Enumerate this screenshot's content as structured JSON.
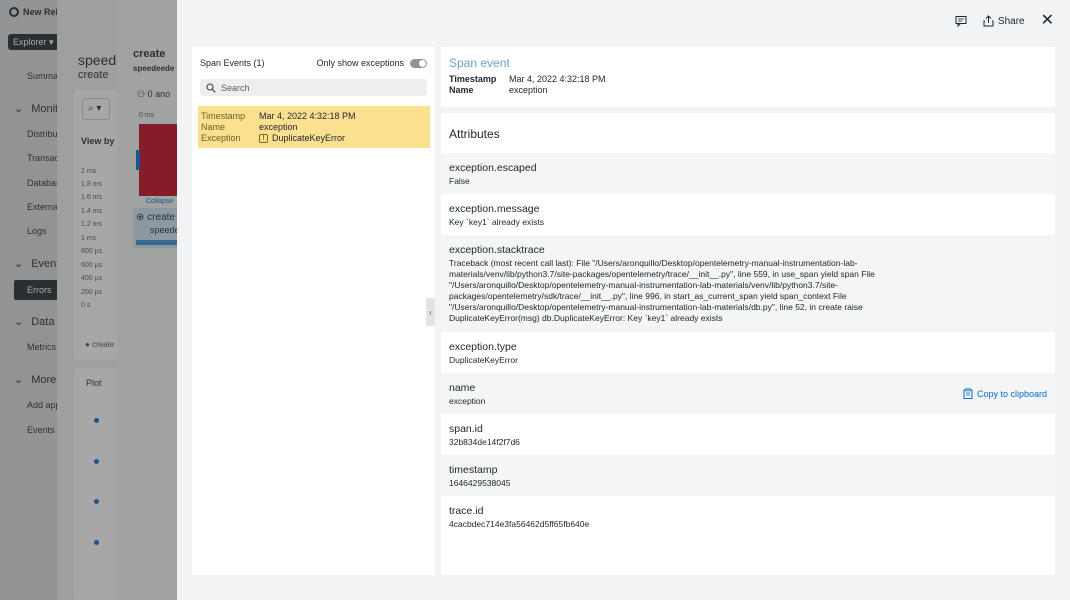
{
  "app": {
    "brand": "New Relic",
    "explorer_label": "Explorer",
    "nav": [
      "Summar",
      "Distribu",
      "Transac",
      "Databas",
      "External",
      "Logs",
      "Metrics",
      "Add app",
      "Events e"
    ],
    "sections": [
      "Monito",
      "Events",
      "Data",
      "More v"
    ],
    "active_item": "Errors"
  },
  "background": {
    "title": "speede",
    "subtitle": "create",
    "view_by": "View by",
    "y_axis": [
      "2 ms",
      "1.8 ms",
      "1.6 ms",
      "1.4 ms",
      "1.2 ms",
      "1 ms",
      "800 µs",
      "600 µs",
      "400 µs",
      "200 µs",
      "0 s"
    ],
    "series_label": "create",
    "plot_label": "Plot",
    "panel_title": "create",
    "panel_sub": "speedeede",
    "anomalies": "0 ano",
    "zero_ms": "0 ms",
    "collapse": "Collapse",
    "span_name": "create",
    "span_sub": "speede"
  },
  "toolbar": {
    "share_label": "Share"
  },
  "span_events": {
    "header": "Span Events (1)",
    "toggle_label": "Only show exceptions",
    "search_placeholder": "Search",
    "row": {
      "timestamp_key": "Timestamp",
      "timestamp": "Mar 4, 2022 4:32:18 PM",
      "name_key": "Name",
      "name": "exception",
      "exception_key": "Exception",
      "exception": "DuplicateKeyError"
    }
  },
  "detail": {
    "title": "Span event",
    "timestamp_key": "Timestamp",
    "timestamp": "Mar 4, 2022 4:32:18 PM",
    "name_key": "Name",
    "name": "exception",
    "attributes_title": "Attributes",
    "copy_label": "Copy to clipboard",
    "attributes": [
      {
        "name": "exception.escaped",
        "value": "False"
      },
      {
        "name": "exception.message",
        "value": "Key `key1` already exists"
      },
      {
        "name": "exception.stacktrace",
        "value": "Traceback (most recent call last): File \"/Users/aronquillo/Desktop/opentelemetry-manual-instrumentation-lab-materials/venv/lib/python3.7/site-packages/opentelemetry/trace/__init__.py\", line 559, in use_span yield span File \"/Users/aronquillo/Desktop/opentelemetry-manual-instrumentation-lab-materials/venv/lib/python3.7/site-packages/opentelemetry/sdk/trace/__init__.py\", line 996, in start_as_current_span yield span_context File \"/Users/aronquillo/Desktop/opentelemetry-manual-instrumentation-lab-materials/db.py\", line 52, in create raise DuplicateKeyError(msg) db.DuplicateKeyError: Key `key1` already exists"
      },
      {
        "name": "exception.type",
        "value": "DuplicateKeyError"
      },
      {
        "name": "name",
        "value": "exception"
      },
      {
        "name": "span.id",
        "value": "32b834de14f2f7d6"
      },
      {
        "name": "timestamp",
        "value": "1646429538045"
      },
      {
        "name": "trace.id",
        "value": "4cacbdec714e3fa56462d5ff65fb640e"
      }
    ]
  }
}
